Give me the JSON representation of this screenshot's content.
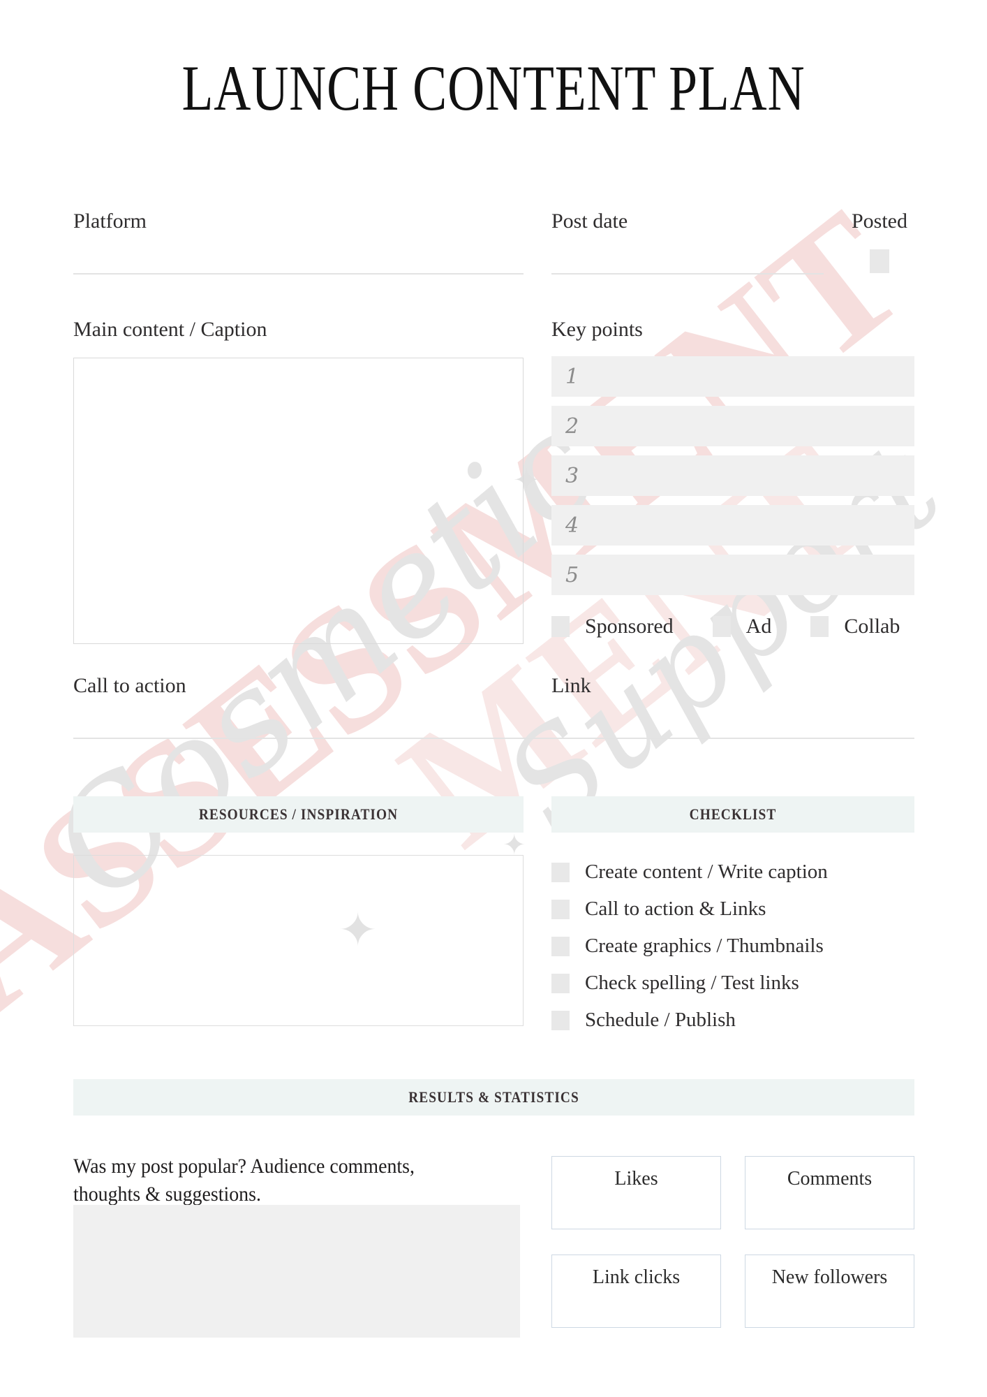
{
  "page": {
    "title": "LAUNCH CONTENT PLAN"
  },
  "watermark": {
    "brand_script": "Cosmetic",
    "brand_script_2": "Support",
    "brand_block": "ASSESSMENT",
    "brand_block_2": "MENT",
    "sparkle_glyph": "✦"
  },
  "fields": {
    "platform": {
      "label": "Platform",
      "value": "",
      "placeholder": ""
    },
    "post_date": {
      "label": "Post date",
      "value": "",
      "placeholder": ""
    },
    "posted": {
      "label": "Posted",
      "checked": false
    },
    "main_content": {
      "label": "Main content / Caption",
      "value": "",
      "placeholder": ""
    },
    "call_to_action": {
      "label": "Call to action",
      "value": "",
      "placeholder": ""
    },
    "link": {
      "label": "Link",
      "value": "",
      "placeholder": ""
    }
  },
  "key_points": {
    "label": "Key points",
    "rows": [
      {
        "number": "1",
        "value": ""
      },
      {
        "number": "2",
        "value": ""
      },
      {
        "number": "3",
        "value": ""
      },
      {
        "number": "4",
        "value": ""
      },
      {
        "number": "5",
        "value": ""
      }
    ]
  },
  "tags": [
    {
      "label": "Sponsored",
      "checked": false
    },
    {
      "label": "Ad",
      "checked": false
    },
    {
      "label": "Collab",
      "checked": false
    }
  ],
  "resources": {
    "heading": "RESOURCES / INSPIRATION",
    "value": ""
  },
  "checklist": {
    "heading": "CHECKLIST",
    "items": [
      {
        "label": "Create content / Write caption",
        "checked": false
      },
      {
        "label": "Call to action & Links",
        "checked": false
      },
      {
        "label": "Create graphics / Thumbnails",
        "checked": false
      },
      {
        "label": "Check spelling / Test links",
        "checked": false
      },
      {
        "label": "Schedule / Publish",
        "checked": false
      }
    ]
  },
  "results": {
    "heading": "RESULTS & STATISTICS",
    "question": "Was my post popular? Audience comments, thoughts & suggestions.",
    "notes_value": "",
    "stats": [
      {
        "label": "Likes",
        "value": ""
      },
      {
        "label": "Comments",
        "value": ""
      },
      {
        "label": "Link clicks",
        "value": ""
      },
      {
        "label": "New followers",
        "value": ""
      }
    ]
  },
  "colors": {
    "section_bar_bg": "#eef4f3",
    "field_fill": "#f0f0f0",
    "checkbox_fill": "#e8e8e8",
    "rule": "#e3e3e3",
    "stat_border": "#cdd8e3",
    "watermark_pink": "#f6dedd",
    "watermark_gray": "#e4e4e4",
    "text": "#2e2c2d"
  }
}
